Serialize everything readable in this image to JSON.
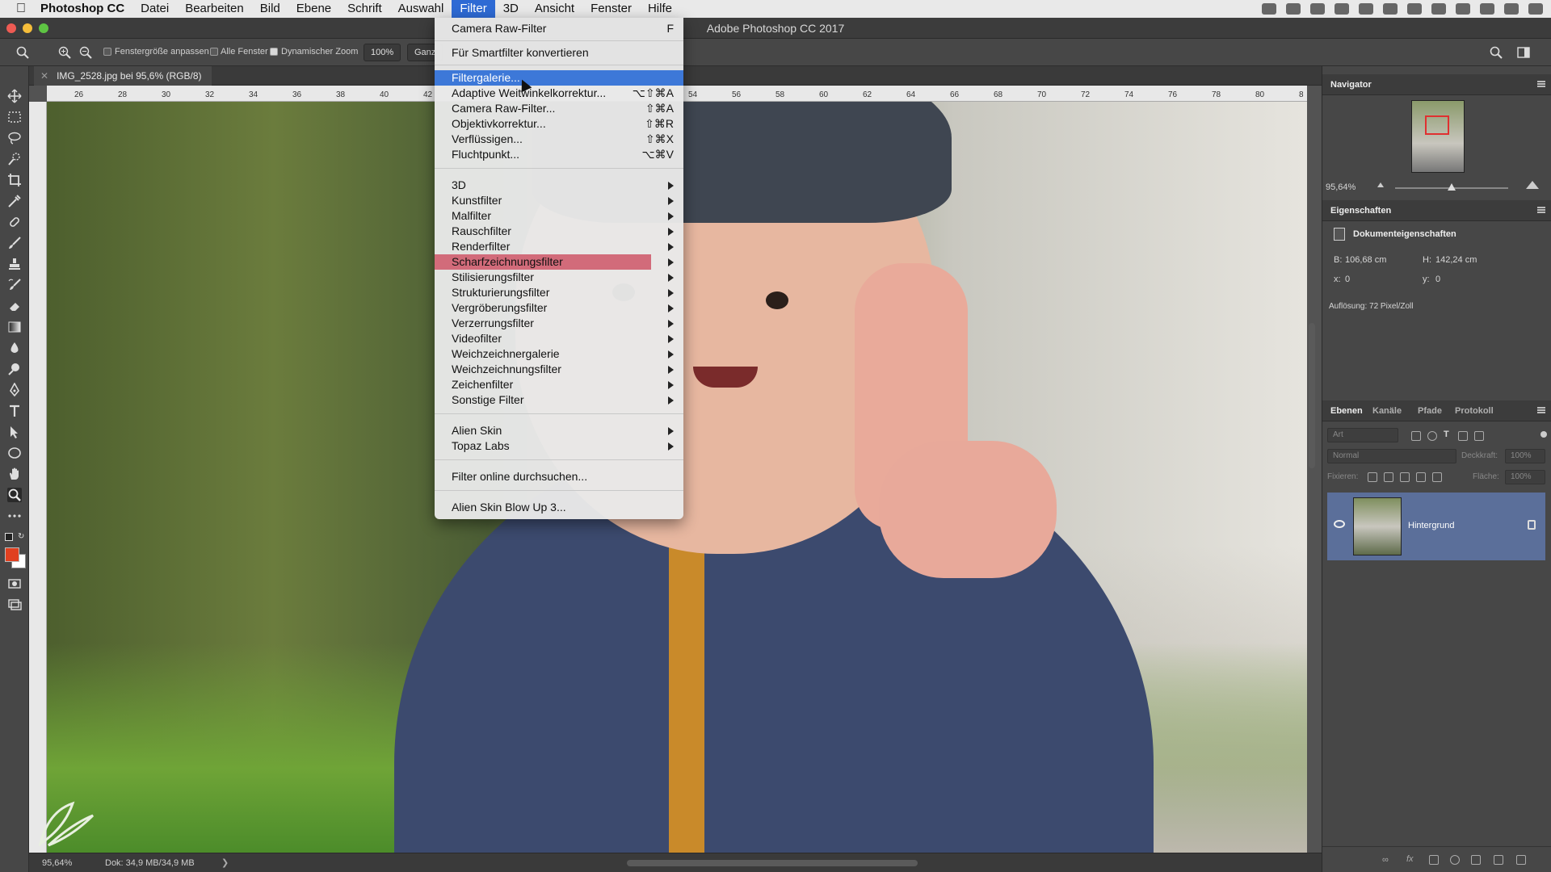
{
  "menubar": {
    "app": "Photoshop CC",
    "items": [
      "Datei",
      "Bearbeiten",
      "Bild",
      "Ebene",
      "Schrift",
      "Auswahl",
      "Filter",
      "3D",
      "Ansicht",
      "Fenster",
      "Hilfe"
    ],
    "active": "Filter"
  },
  "titlebar": {
    "title": "Adobe Photoshop CC 2017"
  },
  "options": {
    "fit_window": "Fenstergröße anpassen",
    "all_windows": "Alle Fenster",
    "dynamic_zoom": "Dynamischer Zoom",
    "zoom_button": "100%",
    "fit_button": "Ganz"
  },
  "document": {
    "tab_title": "IMG_2528.jpg bei 95,6% (RGB/8)",
    "ruler_ticks": [
      "26",
      "28",
      "30",
      "32",
      "34",
      "36",
      "38",
      "40",
      "42",
      "54",
      "56",
      "58",
      "60",
      "62",
      "64",
      "66",
      "68",
      "70",
      "72",
      "74",
      "76",
      "78",
      "80",
      "8"
    ]
  },
  "filter_menu": {
    "items": [
      {
        "label": "Camera Raw-Filter",
        "shortcut": "F"
      },
      {
        "label": "Für Smartfilter konvertieren",
        "shortcut": ""
      },
      {
        "label": "Filtergalerie...",
        "shortcut": ""
      },
      {
        "label": "Adaptive Weitwinkelkorrektur...",
        "shortcut": "⌥⇧⌘A"
      },
      {
        "label": "Camera Raw-Filter...",
        "shortcut": "⇧⌘A"
      },
      {
        "label": "Objektivkorrektur...",
        "shortcut": "⇧⌘R"
      },
      {
        "label": "Verflüssigen...",
        "shortcut": "⇧⌘X"
      },
      {
        "label": "Fluchtpunkt...",
        "shortcut": "⌥⌘V"
      },
      {
        "label": "3D",
        "shortcut": ""
      },
      {
        "label": "Kunstfilter",
        "shortcut": ""
      },
      {
        "label": "Malfilter",
        "shortcut": ""
      },
      {
        "label": "Rauschfilter",
        "shortcut": ""
      },
      {
        "label": "Renderfilter",
        "shortcut": ""
      },
      {
        "label": "Scharfzeichnungsfilter",
        "shortcut": ""
      },
      {
        "label": "Stilisierungsfilter",
        "shortcut": ""
      },
      {
        "label": "Strukturierungsfilter",
        "shortcut": ""
      },
      {
        "label": "Vergröberungsfilter",
        "shortcut": ""
      },
      {
        "label": "Verzerrungsfilter",
        "shortcut": ""
      },
      {
        "label": "Videofilter",
        "shortcut": ""
      },
      {
        "label": "Weichzeichnergalerie",
        "shortcut": ""
      },
      {
        "label": "Weichzeichnungsfilter",
        "shortcut": ""
      },
      {
        "label": "Zeichenfilter",
        "shortcut": ""
      },
      {
        "label": "Sonstige Filter",
        "shortcut": ""
      },
      {
        "label": "Alien Skin",
        "shortcut": ""
      },
      {
        "label": "Topaz Labs",
        "shortcut": ""
      },
      {
        "label": "Filter online durchsuchen...",
        "shortcut": ""
      },
      {
        "label": "Alien Skin Blow Up 3...",
        "shortcut": ""
      }
    ],
    "highlighted": "Filtergalerie...",
    "hovered_submenu": "Scharfzeichnungsfilter"
  },
  "navigator": {
    "title": "Navigator",
    "zoom": "95,64%"
  },
  "properties": {
    "title": "Eigenschaften",
    "section": "Dokumenteigenschaften",
    "w_label": "B:",
    "w_value": "106,68 cm",
    "h_label": "H:",
    "h_value": "142,24 cm",
    "x_label": "x:",
    "x_value": "0",
    "y_label": "y:",
    "y_value": "0",
    "resolution": "Auflösung: 72 Pixel/Zoll"
  },
  "layers": {
    "tabs": [
      "Ebenen",
      "Kanäle",
      "Pfade",
      "Protokoll"
    ],
    "filter_placeholder": "Art",
    "blend_mode": "Normal",
    "opacity_label": "Deckkraft:",
    "opacity_value": "100%",
    "lock_label": "Fixieren:",
    "fill_label": "Fläche:",
    "fill_value": "100%",
    "layer_name": "Hintergrund"
  },
  "status": {
    "zoom": "95,64%",
    "doc": "Dok: 34,9 MB/34,9 MB",
    "arrow": "❯"
  },
  "colors": {
    "menu_highlight": "#3d78d8",
    "submenu_hover": "#d26b7a",
    "foreground_swatch": "#e04020",
    "background_swatch": "#ffffff",
    "layer_selected": "#5b6f9a"
  }
}
